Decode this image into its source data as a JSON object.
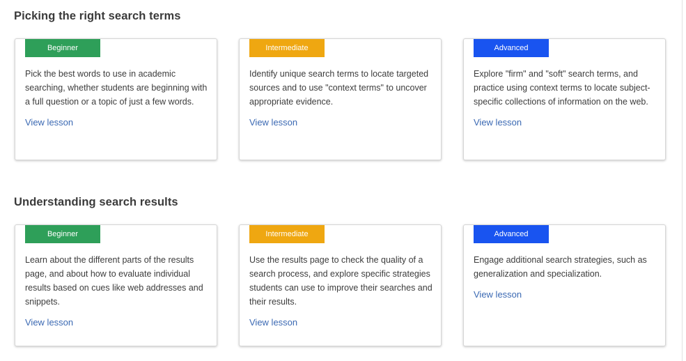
{
  "sections": [
    {
      "title": "Picking the right search terms",
      "cards": [
        {
          "level": "Beginner",
          "description": "Pick the best words to use in academic searching, whether students are beginning with a full question or a topic of just a few words.",
          "link": "View lesson"
        },
        {
          "level": "Intermediate",
          "description": "Identify unique search terms to locate targeted sources and to use \"context terms\" to uncover appropriate evidence.",
          "link": "View lesson"
        },
        {
          "level": "Advanced",
          "description": "Explore \"firm\" and \"soft\" search terms, and practice using context terms to locate subject-specific collections of information on the web.",
          "link": "View lesson"
        }
      ]
    },
    {
      "title": "Understanding search results",
      "cards": [
        {
          "level": "Beginner",
          "description": "Learn about the different parts of the results page, and about how to evaluate individual results based on cues like web addresses and snippets.",
          "link": "View lesson"
        },
        {
          "level": "Intermediate",
          "description": "Use the results page to check the quality of a search process, and explore specific strategies students can use to improve their searches and their results.",
          "link": "View lesson"
        },
        {
          "level": "Advanced",
          "description": "Engage additional search strategies, such as generalization and specialization.",
          "link": "View lesson"
        }
      ]
    }
  ],
  "colors": {
    "beginner": "#2e9f59",
    "intermediate": "#efa711",
    "advanced": "#1954f0",
    "link": "#3b69b3"
  }
}
